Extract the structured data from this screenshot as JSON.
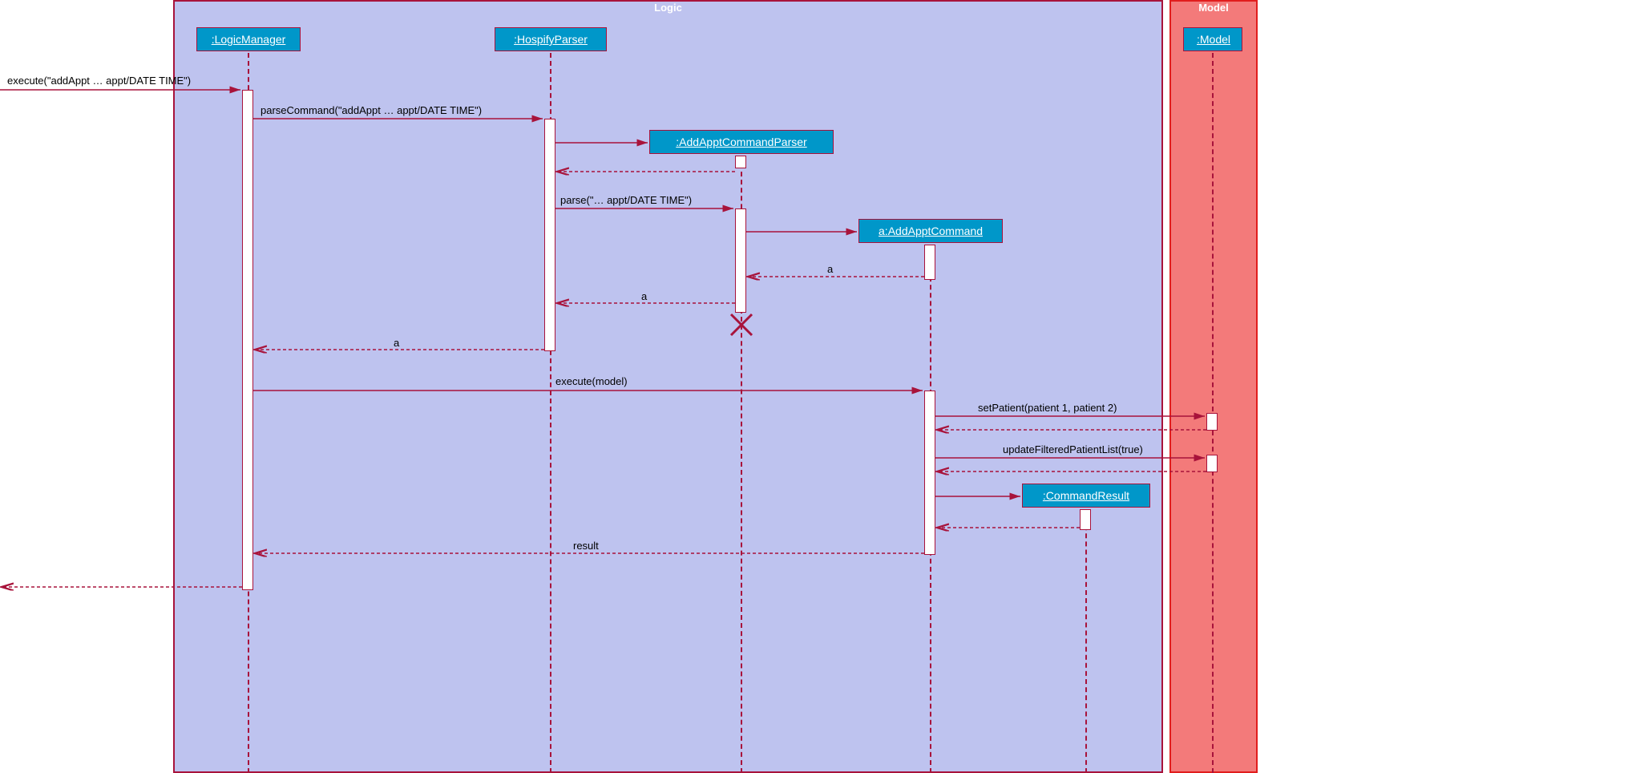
{
  "frames": {
    "logic": {
      "label": "Logic"
    },
    "model": {
      "label": "Model"
    }
  },
  "participants": {
    "logicManager": ":LogicManager",
    "hospifyParser": ":HospifyParser",
    "addApptCommandParser": ":AddApptCommandParser",
    "addApptCommand": "a:AddApptCommand",
    "commandResult": ":CommandResult",
    "model": ":Model"
  },
  "messages": {
    "m1": "execute(\"addAppt … appt/DATE TIME\")",
    "m2": "parseCommand(\"addAppt … appt/DATE TIME\")",
    "m3": "parse(\"… appt/DATE TIME\")",
    "r1": "a",
    "r2": "a",
    "r3": "a",
    "m4": "execute(model)",
    "m5": "setPatient(patient 1, patient 2)",
    "m6": "updateFilteredPatientList(true)",
    "r4": "result"
  },
  "colors": {
    "logicFill": "#bec3ef",
    "logicBorder": "#a8133b",
    "modelFill": "#f37a7a",
    "modelBorder": "#e11d1d",
    "participantFill": "#0097c9",
    "arrow": "#a8133b"
  }
}
